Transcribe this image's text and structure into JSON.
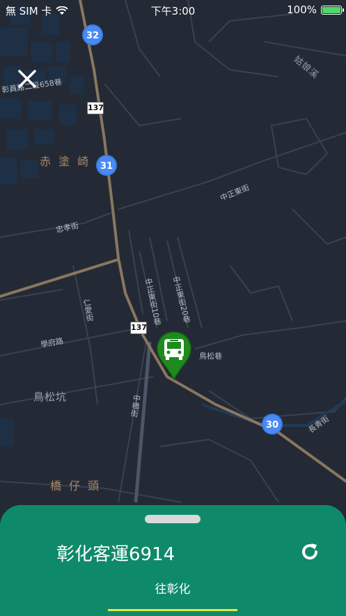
{
  "status_bar": {
    "carrier": "無 SIM 卡",
    "time": "下午3:00",
    "battery_percent": "100%",
    "battery_level": 1.0
  },
  "map": {
    "area_labels": [
      "赤 塗 崎",
      "鳥松坑",
      "橋 仔 頭",
      "姑娘溪"
    ],
    "street_labels": [
      "彰員路二段658巷",
      "中正東街",
      "忠孝街",
      "中正東街10巷",
      "中正東街20巷",
      "仁愛街",
      "學府路",
      "鳥松巷",
      "中橋街",
      "長青街"
    ],
    "route_shields": [
      "137",
      "137"
    ],
    "stops": [
      "32",
      "31",
      "30"
    ],
    "colors": {
      "background": "#232a35",
      "main_road": "#8a7660",
      "street": "#3a4250",
      "stop": "#4a8af4",
      "bus_pin": "#1f8a1f"
    }
  },
  "bus_pin": {
    "icon": "bus-icon"
  },
  "close": {
    "icon": "close-icon"
  },
  "sheet": {
    "title": "彰化客運6914",
    "refresh_icon": "refresh-icon",
    "tab_label": "往彰化",
    "colors": {
      "background": "#0e8a6a",
      "tab_underline": "#e6e645"
    }
  }
}
